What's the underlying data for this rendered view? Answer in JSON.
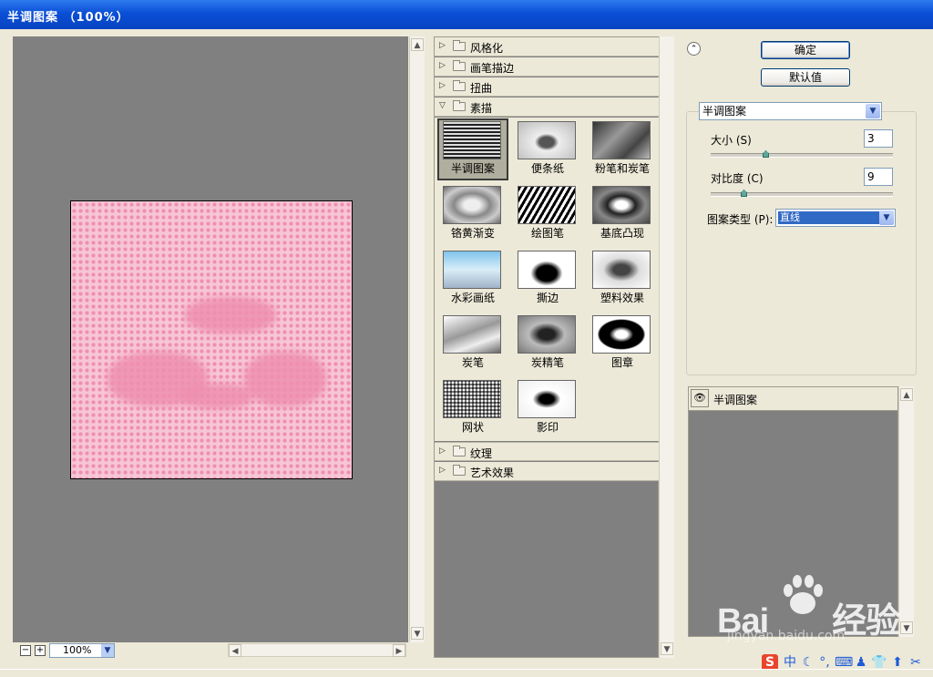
{
  "window": {
    "title": "半调图案 （100%）"
  },
  "preview": {
    "zoom": "100%",
    "zoom_minus": "−",
    "zoom_plus": "+"
  },
  "categories": {
    "stylize": "风格化",
    "brush_strokes": "画笔描边",
    "distort": "扭曲",
    "sketch": "素描",
    "texture": "纹理",
    "artistic": "艺术效果"
  },
  "sketch_filters": [
    {
      "label": "半调图案"
    },
    {
      "label": "便条纸"
    },
    {
      "label": "粉笔和炭笔"
    },
    {
      "label": "铬黄渐变"
    },
    {
      "label": "绘图笔"
    },
    {
      "label": "基底凸现"
    },
    {
      "label": "水彩画纸"
    },
    {
      "label": "撕边"
    },
    {
      "label": "塑料效果"
    },
    {
      "label": "炭笔"
    },
    {
      "label": "炭精笔"
    },
    {
      "label": "图章"
    },
    {
      "label": "网状"
    },
    {
      "label": "影印"
    }
  ],
  "buttons": {
    "ok": "确定",
    "default": "默认值"
  },
  "settings": {
    "filter": "半调图案",
    "size_label": "大小 (S)",
    "size_value": "3",
    "size_level": 0.3,
    "contrast_label": "对比度 (C)",
    "contrast_value": "9",
    "contrast_level": 0.18,
    "pattern_type_label": "图案类型 (P):",
    "pattern_type_value": "直线"
  },
  "layers": [
    {
      "name": "半调图案",
      "visible": true
    }
  ],
  "watermark": {
    "logo": "Bai",
    "logo2": "经验",
    "url": "jingyan.baidu.com"
  },
  "ime": {
    "lang": "中"
  },
  "colors": {
    "title_bar": "#0A4FD6",
    "selection": "#316AC5",
    "preview_bg": "#808080",
    "pattern_pink": "#EE8FAF"
  }
}
